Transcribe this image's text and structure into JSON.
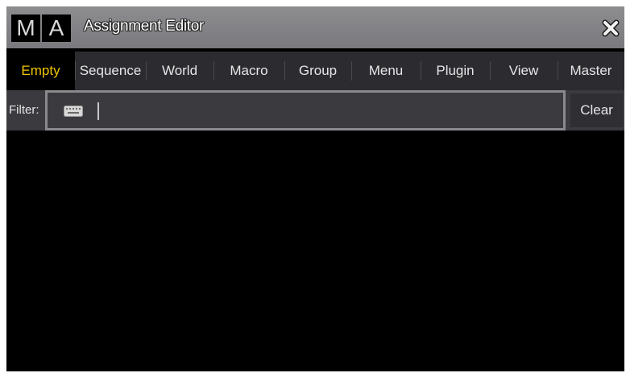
{
  "window": {
    "logo_letters": [
      "M",
      "A"
    ],
    "title": "Assignment Editor"
  },
  "tabs": [
    {
      "label": "Empty",
      "active": true
    },
    {
      "label": "Sequence",
      "active": false
    },
    {
      "label": "World",
      "active": false
    },
    {
      "label": "Macro",
      "active": false
    },
    {
      "label": "Group",
      "active": false
    },
    {
      "label": "Menu",
      "active": false
    },
    {
      "label": "Plugin",
      "active": false
    },
    {
      "label": "View",
      "active": false
    },
    {
      "label": "Master",
      "active": false
    }
  ],
  "filter": {
    "label": "Filter:",
    "value": "",
    "clear_label": "Clear"
  },
  "icons": {
    "close": "close-icon",
    "keyboard": "keyboard-icon"
  },
  "colors": {
    "active_tab_text": "#f0c400",
    "titlebar": "#848488",
    "tabbar": "#2b2b30",
    "content_bg": "#000000"
  }
}
